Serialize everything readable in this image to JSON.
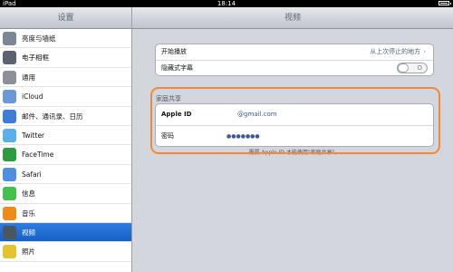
{
  "status_bar": {
    "device": "iPad",
    "time": "18:14"
  },
  "sidebar": {
    "title": "设置",
    "items": [
      {
        "label": "亮度与墙纸",
        "icon": "brightness-icon",
        "color": "#7b8696"
      },
      {
        "label": "电子相框",
        "icon": "picture-frame-icon",
        "color": "#5b6270"
      },
      {
        "label": "通用",
        "icon": "gear-icon",
        "color": "#8b9099"
      },
      {
        "label": "iCloud",
        "icon": "cloud-icon",
        "color": "#6a99d8"
      },
      {
        "label": "邮件、通讯录、日历",
        "icon": "mail-icon",
        "color": "#3d7fd8"
      },
      {
        "label": "Twitter",
        "icon": "twitter-icon",
        "color": "#5ab0e8"
      },
      {
        "label": "FaceTime",
        "icon": "facetime-icon",
        "color": "#2c9c3f"
      },
      {
        "label": "Safari",
        "icon": "safari-icon",
        "color": "#4f8fe0"
      },
      {
        "label": "信息",
        "icon": "messages-icon",
        "color": "#43c14c"
      },
      {
        "label": "音乐",
        "icon": "music-icon",
        "color": "#f08a1a"
      },
      {
        "label": "视频",
        "icon": "video-icon",
        "color": "#4d5560"
      },
      {
        "label": "照片",
        "icon": "photos-icon",
        "color": "#e6c22e"
      }
    ],
    "selected_index": 10
  },
  "main": {
    "title": "视频",
    "playback": {
      "start_label": "开始播放",
      "start_value": "从上次停止的地方",
      "cc_label": "隐藏式字幕",
      "cc_toggle_text": "O"
    },
    "home_sharing": {
      "section_title": "家庭共享",
      "apple_id_label": "Apple ID",
      "apple_id_value": "@gmail.com",
      "password_label": "密码",
      "password_value": "●●●●●●●",
      "note": "需要 Apple ID 才能使用\"家庭共享\"。"
    },
    "highlight_color": "#f2893a"
  },
  "colors": {
    "selected": "#1f6fd6"
  }
}
